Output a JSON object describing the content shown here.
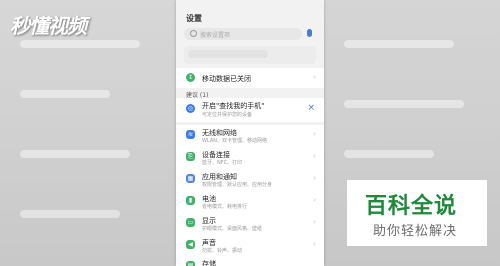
{
  "watermark": "秒懂视频",
  "settings": {
    "title": "设置",
    "search_placeholder": "搜索设置项",
    "mobile_data": "移动数据已关闭",
    "suggestions_header": "建议 (1)",
    "suggestion": {
      "title": "开启\"查找我的手机\"",
      "subtitle": "可定位并保护您的设备"
    },
    "items": [
      {
        "label": "无线和网络",
        "sub": "WLAN、双卡管理、移动网络",
        "color": "#3a7bf2"
      },
      {
        "label": "设备连接",
        "sub": "蓝牙、NFC、打印",
        "color": "#3fb36b"
      },
      {
        "label": "应用和通知",
        "sub": "权限管理、默认应用、应用分身",
        "color": "#5a83ea"
      },
      {
        "label": "电池",
        "sub": "省电模式、耗电排行",
        "color": "#3fb36b"
      },
      {
        "label": "显示",
        "sub": "护眼模式、桌面风格、壁纸",
        "color": "#3fb36b"
      },
      {
        "label": "声音",
        "sub": "勿扰、铃声、振动",
        "color": "#3fb36b"
      },
      {
        "label": "存储",
        "sub": "",
        "color": "#3fb36b"
      }
    ]
  },
  "brand": {
    "title": "百科全说",
    "subtitle": "助你轻松解决"
  }
}
